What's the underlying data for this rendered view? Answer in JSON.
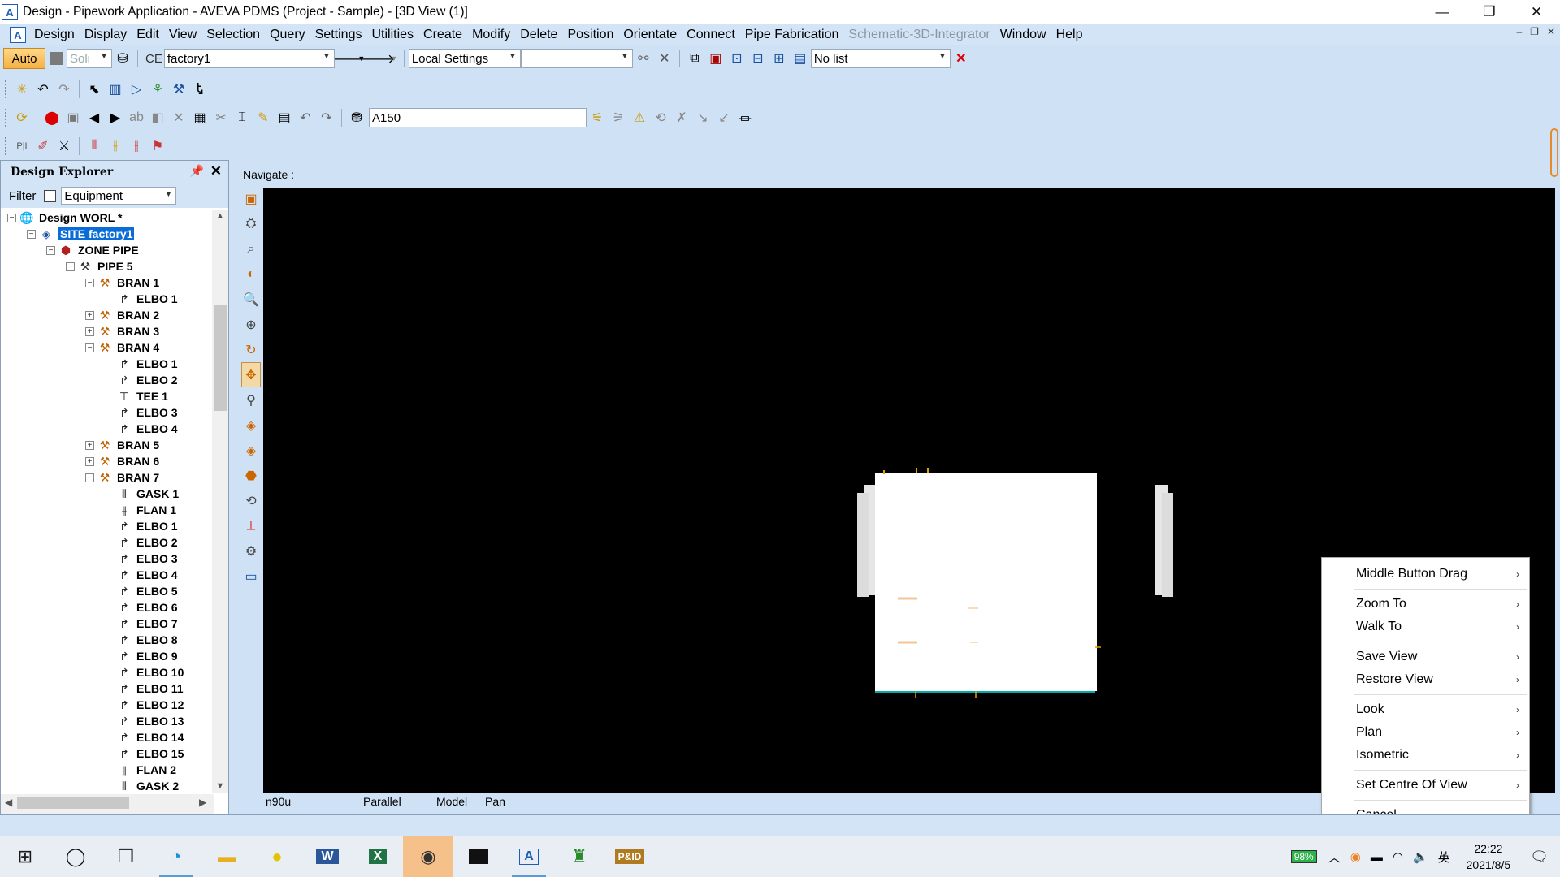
{
  "window": {
    "title": "Design - Pipework Application - AVEVA PDMS (Project - Sample) - [3D View (1)]",
    "app_icon": "A",
    "controls": {
      "minimize": "—",
      "restore": "❐",
      "close": "✕"
    }
  },
  "menubar": {
    "items": [
      "Design",
      "Display",
      "Edit",
      "View",
      "Selection",
      "Query",
      "Settings",
      "Utilities",
      "Create",
      "Modify",
      "Delete",
      "Position",
      "Orientate",
      "Connect",
      "Pipe Fabrication",
      "Schematic-3D-Integrator",
      "Window",
      "Help"
    ],
    "disabled": [
      "Schematic-3D-Integrator"
    ]
  },
  "toolbar1": {
    "auto_label": "Auto",
    "solid_value": "Soli",
    "ce_label": "CE",
    "ce_value": "factory1",
    "settings_value": "Local Settings",
    "list_value": "No list"
  },
  "toolbar3": {
    "spec_value": "A150"
  },
  "explorer": {
    "title": "Design Explorer",
    "filter_label": "Filter",
    "filter_value": "Equipment",
    "tree": [
      {
        "label": "Design WORL *",
        "level": 0,
        "exp": "−",
        "icon": "world-icon"
      },
      {
        "label": "SITE factory1",
        "level": 1,
        "exp": "−",
        "icon": "site-icon",
        "selected": true
      },
      {
        "label": "ZONE PIPE",
        "level": 2,
        "exp": "−",
        "icon": "zone-icon"
      },
      {
        "label": "PIPE 5",
        "level": 3,
        "exp": "−",
        "icon": "pipe-icon"
      },
      {
        "label": "BRAN 1",
        "level": 4,
        "exp": "−",
        "icon": "branch-icon"
      },
      {
        "label": "ELBO 1",
        "level": 5,
        "exp": "",
        "icon": "elbow-icon"
      },
      {
        "label": "BRAN 2",
        "level": 4,
        "exp": "+",
        "icon": "branch-icon"
      },
      {
        "label": "BRAN 3",
        "level": 4,
        "exp": "+",
        "icon": "branch-icon"
      },
      {
        "label": "BRAN 4",
        "level": 4,
        "exp": "−",
        "icon": "branch-icon"
      },
      {
        "label": "ELBO 1",
        "level": 5,
        "exp": "",
        "icon": "elbow-icon"
      },
      {
        "label": "ELBO 2",
        "level": 5,
        "exp": "",
        "icon": "elbow-icon"
      },
      {
        "label": "TEE 1",
        "level": 5,
        "exp": "",
        "icon": "tee-icon"
      },
      {
        "label": "ELBO 3",
        "level": 5,
        "exp": "",
        "icon": "elbow-icon"
      },
      {
        "label": "ELBO 4",
        "level": 5,
        "exp": "",
        "icon": "elbow-icon"
      },
      {
        "label": "BRAN 5",
        "level": 4,
        "exp": "+",
        "icon": "branch-icon"
      },
      {
        "label": "BRAN 6",
        "level": 4,
        "exp": "+",
        "icon": "branch-icon"
      },
      {
        "label": "BRAN 7",
        "level": 4,
        "exp": "−",
        "icon": "branch-icon"
      },
      {
        "label": "GASK 1",
        "level": 5,
        "exp": "",
        "icon": "gasket-icon"
      },
      {
        "label": "FLAN 1",
        "level": 5,
        "exp": "",
        "icon": "flange-icon"
      },
      {
        "label": "ELBO 1",
        "level": 5,
        "exp": "",
        "icon": "elbow-icon"
      },
      {
        "label": "ELBO 2",
        "level": 5,
        "exp": "",
        "icon": "elbow-icon"
      },
      {
        "label": "ELBO 3",
        "level": 5,
        "exp": "",
        "icon": "elbow-icon"
      },
      {
        "label": "ELBO 4",
        "level": 5,
        "exp": "",
        "icon": "elbow-icon"
      },
      {
        "label": "ELBO 5",
        "level": 5,
        "exp": "",
        "icon": "elbow-icon"
      },
      {
        "label": "ELBO 6",
        "level": 5,
        "exp": "",
        "icon": "elbow-icon"
      },
      {
        "label": "ELBO 7",
        "level": 5,
        "exp": "",
        "icon": "elbow-icon"
      },
      {
        "label": "ELBO 8",
        "level": 5,
        "exp": "",
        "icon": "elbow-icon"
      },
      {
        "label": "ELBO 9",
        "level": 5,
        "exp": "",
        "icon": "elbow-icon"
      },
      {
        "label": "ELBO 10",
        "level": 5,
        "exp": "",
        "icon": "elbow-icon"
      },
      {
        "label": "ELBO 11",
        "level": 5,
        "exp": "",
        "icon": "elbow-icon"
      },
      {
        "label": "ELBO 12",
        "level": 5,
        "exp": "",
        "icon": "elbow-icon"
      },
      {
        "label": "ELBO 13",
        "level": 5,
        "exp": "",
        "icon": "elbow-icon"
      },
      {
        "label": "ELBO 14",
        "level": 5,
        "exp": "",
        "icon": "elbow-icon"
      },
      {
        "label": "ELBO 15",
        "level": 5,
        "exp": "",
        "icon": "elbow-icon"
      },
      {
        "label": "FLAN 2",
        "level": 5,
        "exp": "",
        "icon": "flange-icon"
      },
      {
        "label": "GASK 2",
        "level": 5,
        "exp": "",
        "icon": "gasket-icon"
      }
    ]
  },
  "view": {
    "navigate_label": "Navigate :",
    "status": {
      "direction": "n90u",
      "projection": "Parallel",
      "mode": "Model",
      "action": "Pan"
    }
  },
  "context_menu": {
    "groups": [
      [
        {
          "label": "Middle Button Drag",
          "submenu": true
        }
      ],
      [
        {
          "label": "Zoom To",
          "submenu": true
        },
        {
          "label": "Walk To",
          "submenu": true
        }
      ],
      [
        {
          "label": "Save View",
          "submenu": true
        },
        {
          "label": "Restore View",
          "submenu": true
        }
      ],
      [
        {
          "label": "Look",
          "submenu": true
        },
        {
          "label": "Plan",
          "submenu": true
        },
        {
          "label": "Isometric",
          "submenu": true
        }
      ],
      [
        {
          "label": "Set Centre Of View",
          "submenu": true
        }
      ],
      [
        {
          "label": "Cancel",
          "submenu": false
        }
      ]
    ]
  },
  "taskbar": {
    "apps": [
      "start-icon",
      "cortana-icon",
      "task-view-icon",
      "edge-icon",
      "file-explorer-icon",
      "app-icon",
      "word-icon",
      "excel-icon",
      "app-icon",
      "terminal-icon",
      "aveva-icon",
      "app-icon",
      "pid-icon"
    ],
    "battery": "98%",
    "ime": "英",
    "time": "22:22",
    "date": "2021/8/5"
  }
}
